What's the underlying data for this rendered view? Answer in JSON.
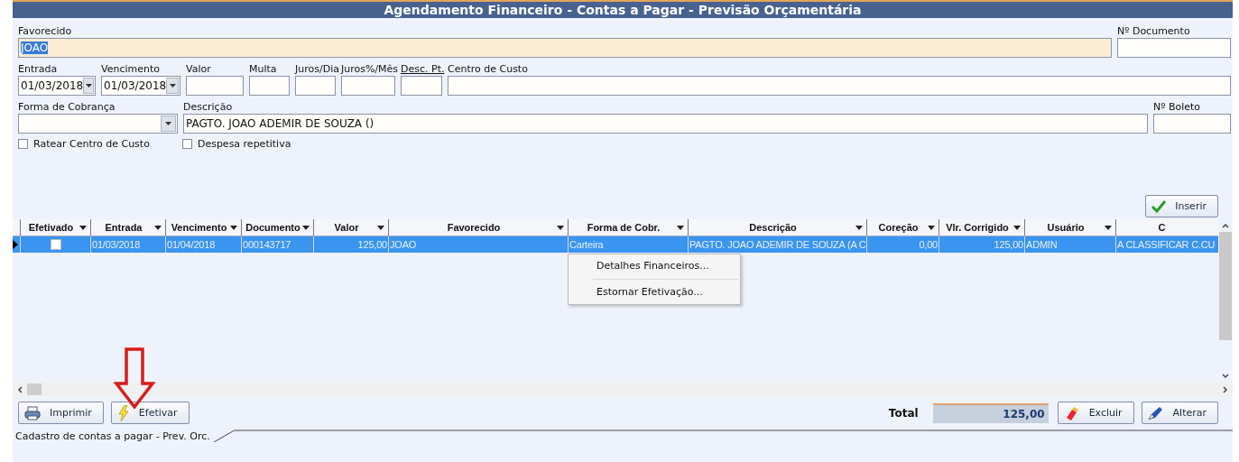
{
  "window": {
    "title": "Agendamento Financeiro - Contas a Pagar - Previsão Orçamentária"
  },
  "form_rows": [
    {
      "fields": [
        {
          "label": "Favorecido",
          "kind": "text",
          "value": "JOAO",
          "highlighted": true,
          "value_selected": true
        },
        {
          "label": "Nº Documento",
          "kind": "text"
        }
      ]
    },
    {
      "fields": [
        {
          "label": "Entrada",
          "kind": "dropdown",
          "value": "01/03/2018"
        },
        {
          "label": "Vencimento",
          "kind": "dropdown",
          "value": "01/03/2018"
        },
        {
          "label": "Valor",
          "kind": "text"
        },
        {
          "label": "Multa",
          "kind": "text"
        },
        {
          "label": "Juros/Dia",
          "kind": "text"
        },
        {
          "label": "Juros%/Mês",
          "kind": "text"
        },
        {
          "label": "Desc. Pt.",
          "kind": "text",
          "label_underlined": true
        },
        {
          "label": "Centro de Custo",
          "kind": "text"
        }
      ]
    },
    {
      "fields": [
        {
          "label": "Forma de Cobrança",
          "kind": "dropdown"
        },
        {
          "label": "Descrição",
          "kind": "text",
          "value": "PAGTO. JOAO ADEMIR DE SOUZA ()"
        },
        {
          "label": "Nº Boleto",
          "kind": "text"
        }
      ]
    }
  ],
  "checkboxes": [
    {
      "label": "Ratear Centro de Custo",
      "checked": false
    },
    {
      "label": "Despesa repetitiva",
      "checked": false
    }
  ],
  "insert_button": "Inserir",
  "table": {
    "checkbox_column": "Efetivado",
    "columns": [
      "Entrada",
      "Vencimento",
      "Documento",
      "Valor",
      "Favorecido",
      "Forma de Cobr.",
      "Descrição",
      "Coreção",
      "Vlr. Corrigido",
      "Usuário",
      "C"
    ],
    "rows": [
      {
        "selected": true,
        "efetivado": false,
        "cells": [
          "01/03/2018",
          "01/04/2018",
          "000143717",
          "125,00",
          "JOAO",
          "Carteira",
          "PAGTO. JOAO ADEMIR DE SOUZA (A C",
          "0,00",
          "125,00",
          "ADMIN",
          "A CLASSIFICAR  C.CU"
        ]
      }
    ]
  },
  "context_menu": [
    "Detalhes Financeiros...",
    "Estornar Efetivação..."
  ],
  "footer": {
    "left_buttons": [
      "Imprimir",
      "Efetivar"
    ],
    "total_label": "Total",
    "total_value": "125,00",
    "right_buttons": [
      "Excluir",
      "Alterar"
    ]
  },
  "status_tab": "Cadastro de contas a pagar - Prev. Orc."
}
